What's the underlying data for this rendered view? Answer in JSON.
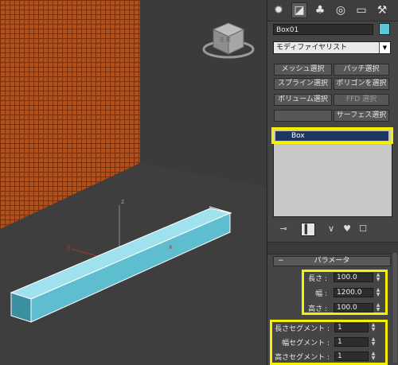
{
  "command_panel": {
    "tabs": [
      "create-icon",
      "modify-icon",
      "hierarchy-icon",
      "motion-icon",
      "display-icon",
      "utilities-icon"
    ],
    "object_name": "Box01",
    "object_color": "#5bc6d8",
    "modifier_list": "モディファイヤリスト",
    "modifier_buttons": [
      {
        "label": "メッシュ選択"
      },
      {
        "label": "パッチ選択"
      },
      {
        "label": "スプライン選択"
      },
      {
        "label": "ポリゴンを選択"
      },
      {
        "label": "ボリューム選択"
      },
      {
        "label": "FFD 選択"
      },
      {
        "label": ""
      },
      {
        "label": "サーフェス選択"
      }
    ],
    "stack_items": [
      "Box"
    ],
    "rollout_title": "パラメータ",
    "params": [
      {
        "label": "長さ :",
        "value": "100.0"
      },
      {
        "label": "幅 :",
        "value": "1200.0"
      },
      {
        "label": "高さ :",
        "value": "100.0"
      }
    ],
    "segments": [
      {
        "label": "長さセグメント :",
        "value": "1"
      },
      {
        "label": "幅セグメント :",
        "value": "1"
      },
      {
        "label": "高さセグメント :",
        "value": "1"
      }
    ]
  },
  "viewport": {
    "viewcube_face": "左 前",
    "axis_labels": {
      "x": "x",
      "y": "y",
      "z": "z"
    },
    "box_color": "#5fbdd0",
    "wall_color": "#b64d12"
  },
  "colors": {
    "highlight": "#f5f000"
  }
}
